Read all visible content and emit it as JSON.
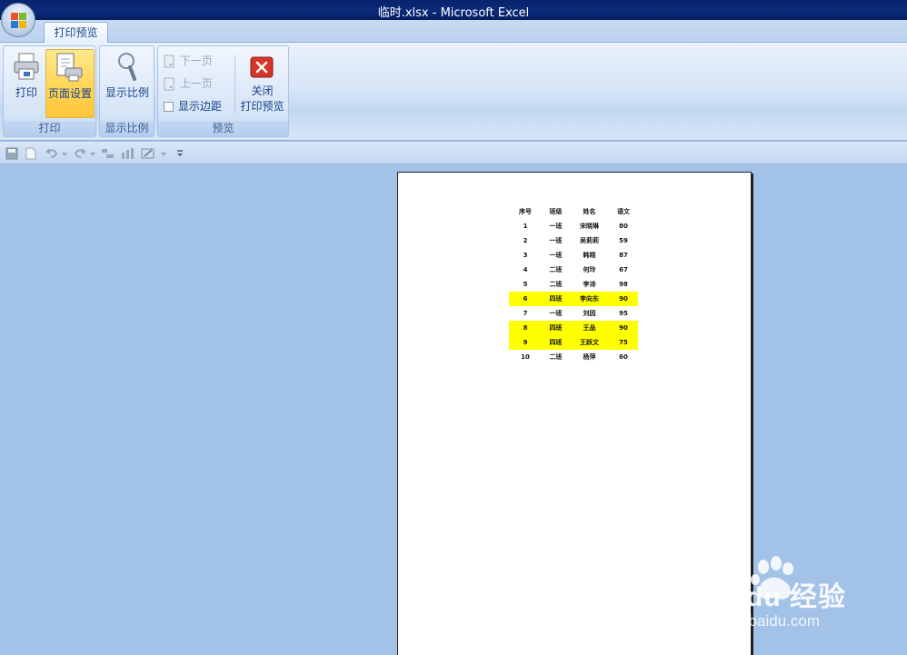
{
  "window": {
    "title": "临时.xlsx - Microsoft Excel"
  },
  "tabs": [
    {
      "label": "打印预览"
    }
  ],
  "ribbon": {
    "print_group": {
      "label": "打印",
      "print_btn": "打印",
      "page_setup_btn": "页面设置"
    },
    "zoom_group": {
      "label": "显示比例",
      "zoom_btn": "显示比例"
    },
    "preview_group": {
      "label": "预览",
      "next_page": "下一页",
      "prev_page": "上一页",
      "show_margins": "显示边距",
      "close_line1": "关闭",
      "close_line2": "打印预览"
    }
  },
  "sheet": {
    "headers": [
      "序号",
      "班级",
      "姓名",
      "语文"
    ],
    "rows": [
      [
        "1",
        "一班",
        "宋晓琳",
        "80"
      ],
      [
        "2",
        "一班",
        "吴莉莉",
        "59"
      ],
      [
        "3",
        "一班",
        "韩晓",
        "87"
      ],
      [
        "4",
        "二班",
        "何玲",
        "67"
      ],
      [
        "5",
        "二班",
        "李诗",
        "98"
      ],
      [
        "6",
        "四班",
        "李向东",
        "90"
      ],
      [
        "7",
        "一班",
        "刘因",
        "95"
      ],
      [
        "8",
        "四班",
        "王品",
        "90"
      ],
      [
        "9",
        "四班",
        "王跃文",
        "75"
      ],
      [
        "10",
        "二班",
        "杨萍",
        "60"
      ]
    ],
    "highlight_color": "#ffff00"
  },
  "watermark": {
    "brand": "Bai du 经验",
    "url": "jingyan.baidu.com"
  }
}
